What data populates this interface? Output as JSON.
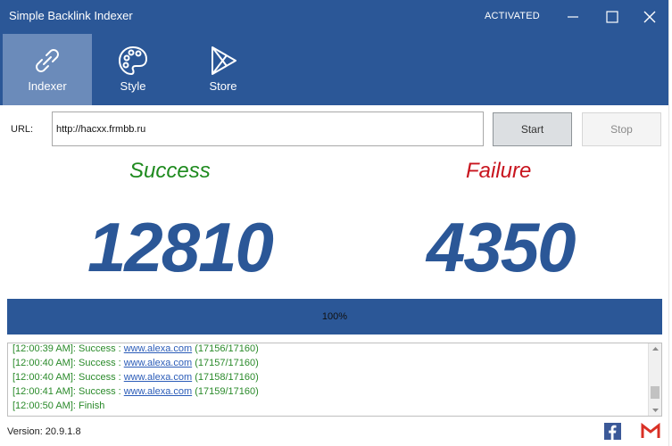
{
  "window": {
    "title": "Simple Backlink Indexer",
    "status": "ACTIVATED",
    "controls": {
      "minimize_icon": "minimize-icon",
      "maximize_icon": "maximize-icon",
      "close_icon": "close-icon"
    }
  },
  "tabs": [
    {
      "label": "Indexer",
      "icon": "link-icon",
      "active": true
    },
    {
      "label": "Style",
      "icon": "palette-icon",
      "active": false
    },
    {
      "label": "Store",
      "icon": "play-store-icon",
      "active": false
    }
  ],
  "url_row": {
    "label": "URL:",
    "value": "http://hacxx.frmbb.ru",
    "start_label": "Start",
    "stop_label": "Stop"
  },
  "stats": {
    "success_label": "Success",
    "success_value": "12810",
    "failure_label": "Failure",
    "failure_value": "4350"
  },
  "progress": {
    "text": "100%",
    "value": 1.0
  },
  "log": [
    {
      "prefix": "[12:00:39 AM]: Success : ",
      "link": "www.alexa.com",
      "suffix": " (17156/17160)"
    },
    {
      "prefix": "[12:00:40 AM]: Success : ",
      "link": "www.alexa.com",
      "suffix": " (17157/17160)"
    },
    {
      "prefix": "[12:00:40 AM]: Success : ",
      "link": "www.alexa.com",
      "suffix": " (17158/17160)"
    },
    {
      "prefix": "[12:00:41 AM]: Success : ",
      "link": "www.alexa.com",
      "suffix": " (17159/17160)"
    },
    {
      "prefix": "[12:00:50 AM]: Finish",
      "link": "",
      "suffix": ""
    }
  ],
  "footer": {
    "version": "Version: 20.9.1.8",
    "facebook_icon": "facebook-icon",
    "gmail_icon": "gmail-icon"
  },
  "colors": {
    "primary": "#2b5797",
    "active_tab": "#6b8bba",
    "success": "#1e8a1e",
    "failure": "#c8141e",
    "link": "#2b5cb8"
  }
}
